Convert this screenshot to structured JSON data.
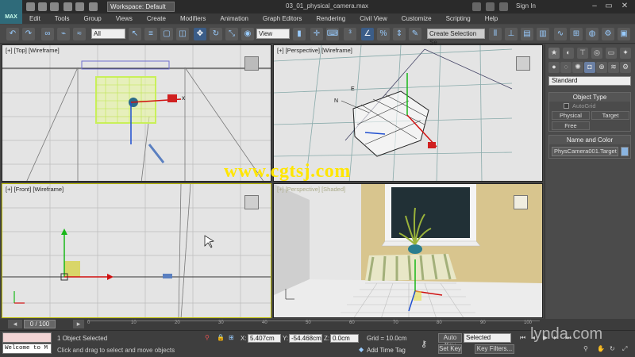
{
  "app": {
    "logo_text": "MAX",
    "workspace": "Workspace: Default",
    "file_title": "03_01_physical_camera.max",
    "sign_in": "Sign In"
  },
  "menu": [
    "Edit",
    "Tools",
    "Group",
    "Views",
    "Create",
    "Modifiers",
    "Animation",
    "Graph Editors",
    "Rendering",
    "Civil View",
    "Customize",
    "Scripting",
    "Help"
  ],
  "toolbar": {
    "selection_filter": "All",
    "ref_coord": "View",
    "selection_set_placeholder": "Create Selection Se"
  },
  "viewports": {
    "top": "[+] [Top] [Wireframe]",
    "perspective": "[+] [Perspective] [Wireframe]",
    "front": "[+] [Front] [Wireframe]",
    "camera": "[+] [Perspective] [Shaded]"
  },
  "axes": {
    "x": "x",
    "y": "y",
    "z": "z",
    "e": "E",
    "n": "N"
  },
  "command_panel": {
    "category_select": "Standard",
    "object_type_title": "Object Type",
    "autogrid_label": "AutoGrid",
    "btn_physical": "Physical",
    "btn_target": "Target",
    "btn_free": "Free",
    "name_color_title": "Name and Color",
    "object_name": "PhysCamera001.Target",
    "swatch_color": "#8ab4e0"
  },
  "timeline": {
    "frame_display": "0 / 100",
    "ticks": [
      "0",
      "10",
      "20",
      "30",
      "40",
      "50",
      "60",
      "70",
      "80",
      "90",
      "100"
    ]
  },
  "status": {
    "maxscript_text": "Welcome to M",
    "selection_status": "1 Object Selected",
    "prompt": "Click and drag to select and move objects",
    "x_label": "X:",
    "x_value": "5.407cm",
    "y_label": "Y:",
    "y_value": "-54.468cm",
    "z_label": "Z:",
    "z_value": "0.0cm",
    "grid": "Grid = 10.0cm",
    "add_time_tag": "Add Time Tag",
    "auto_key": "Auto Key",
    "selected_dropdown": "Selected",
    "set_key": "Set Key",
    "key_filters": "Key Filters..."
  },
  "overlays": {
    "watermark": "www.cgtsj.com",
    "lynda": "lynda.com"
  }
}
